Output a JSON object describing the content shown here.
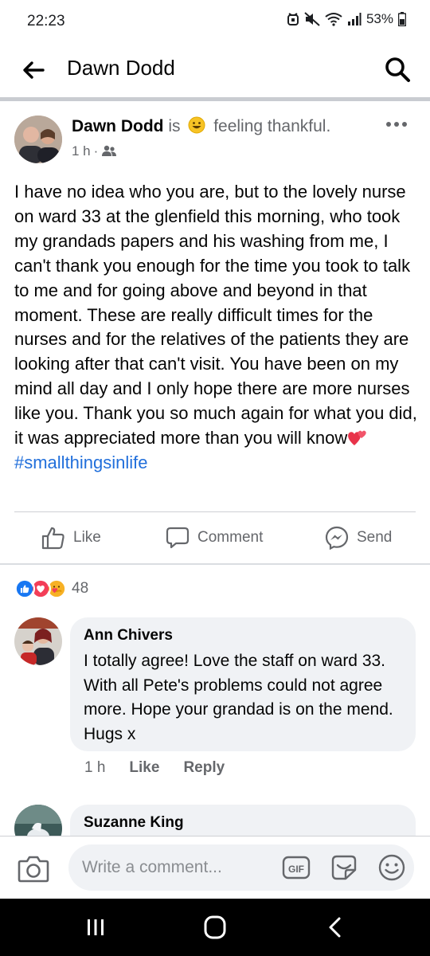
{
  "status_bar": {
    "time": "22:23",
    "battery": "53%"
  },
  "header": {
    "title": "Dawn Dodd",
    "back_icon": "arrow-left-icon",
    "search_icon": "search-icon"
  },
  "post": {
    "author": "Dawn Dodd",
    "is_text": "is",
    "feeling_text": "feeling thankful.",
    "time": "1 h",
    "meta_separator": "·",
    "audience_icon": "friends-icon",
    "body": "I have no idea who you are, but to the lovely nurse on ward 33 at the glenfield this morning, who took my grandads papers and his washing from me, I can't thank you enough for the time you took to talk to me and for going above and beyond in that moment. These are really difficult times for the nurses and for the relatives of the patients they are looking after that can't visit. You have been on my mind all day and I only hope there are more nurses like you. Thank you so much again for what you did, it was appreciated more than you will know",
    "hashtag": "#smallthingsinlife",
    "hashtag_color": "#216fdb"
  },
  "actions": {
    "like": "Like",
    "comment": "Comment",
    "send": "Send"
  },
  "reactions": {
    "count": "48",
    "types": [
      "like",
      "love",
      "care"
    ]
  },
  "comments": [
    {
      "author": "Ann Chivers",
      "text": "I totally agree! Love the staff on ward 33. With all Pete's problems could not  agree more. Hope your grandad is on the mend. Hugs x",
      "time": "1 h",
      "like_label": "Like",
      "reply_label": "Reply"
    },
    {
      "author": "Suzanne King"
    }
  ],
  "composer": {
    "placeholder": "Write a comment...",
    "gif_label": "GIF"
  },
  "colors": {
    "like_blue": "#1877f2",
    "love_red": "#f33e58",
    "care_yellow": "#f7b125",
    "meta_gray": "#65676b"
  }
}
